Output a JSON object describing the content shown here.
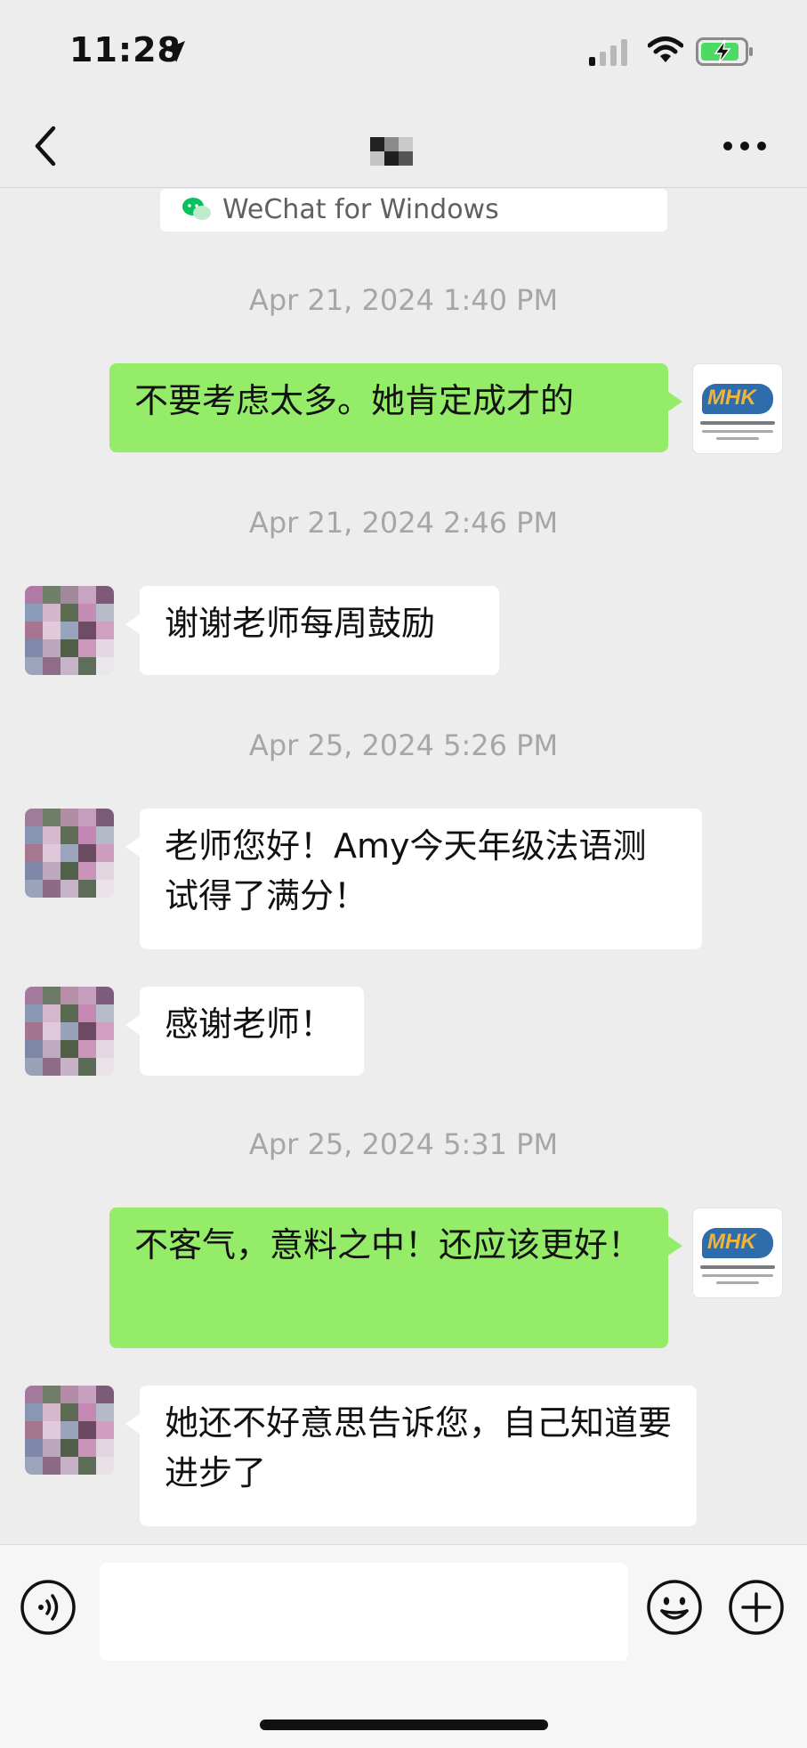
{
  "status_bar": {
    "time": "11:28"
  },
  "header": {
    "contact_name": ""
  },
  "source_card": {
    "label": "WeChat for Windows"
  },
  "messages": [
    {
      "type": "timestamp",
      "text": "Apr 21, 2024 1:40 PM"
    },
    {
      "type": "sent",
      "text": "不要考虑太多。她肯定成才的"
    },
    {
      "type": "timestamp",
      "text": "Apr 21, 2024 2:46 PM"
    },
    {
      "type": "received",
      "text": "谢谢老师每周鼓励"
    },
    {
      "type": "timestamp",
      "text": "Apr 25, 2024 5:26 PM"
    },
    {
      "type": "received",
      "text": "老师您好！Amy今天年级法语测试得了满分！"
    },
    {
      "type": "received",
      "text": "感谢老师！"
    },
    {
      "type": "timestamp",
      "text": "Apr 25, 2024 5:31 PM"
    },
    {
      "type": "sent",
      "text": "不客气，意料之中！还应该更好！"
    },
    {
      "type": "received",
      "text": "她还不好意思告诉您，自己知道要进步了"
    }
  ],
  "sender_avatar": {
    "logo_text": "MHK"
  },
  "composer": {
    "value": "",
    "placeholder": ""
  },
  "colors": {
    "sent_bubble": "#95ec69",
    "received_bubble": "#ffffff",
    "background": "#ededed",
    "timestamp": "#a6a6a6"
  },
  "icons": [
    "location-arrow-icon",
    "signal-icon",
    "wifi-icon",
    "battery-charging-icon",
    "back-chevron-icon",
    "more-dots-icon",
    "wechat-icon",
    "voice-icon",
    "emoji-icon",
    "plus-icon"
  ]
}
